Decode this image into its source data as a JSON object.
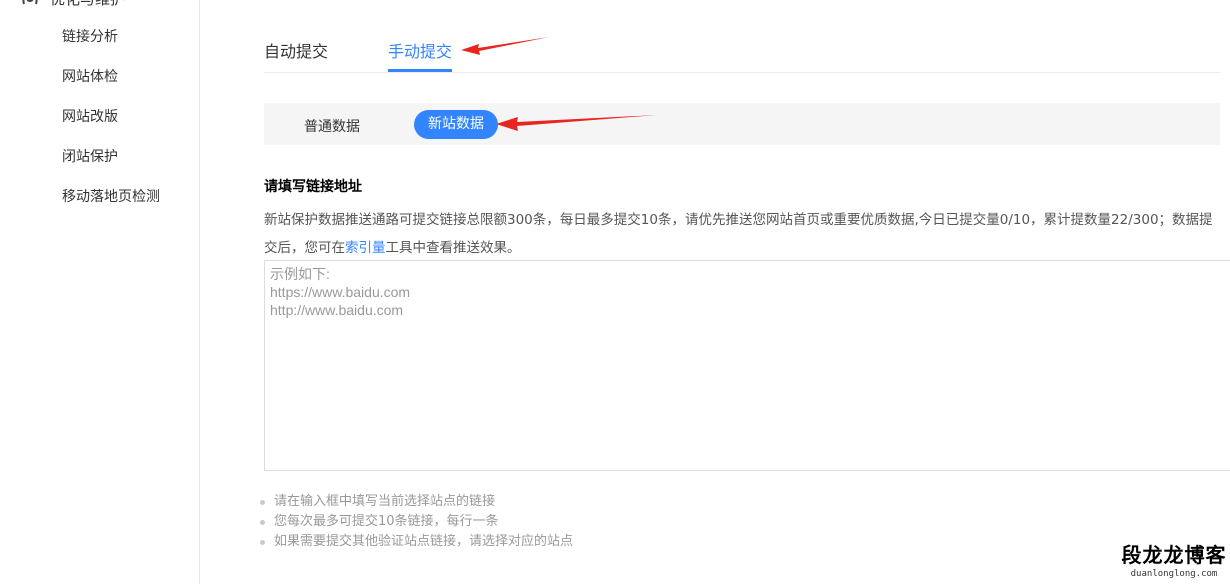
{
  "sidebar": {
    "top_label": "优化与维护",
    "top_chevron": "^",
    "items": [
      {
        "label": "链接分析"
      },
      {
        "label": "网站体检"
      },
      {
        "label": "网站改版"
      },
      {
        "label": "闭站保护"
      },
      {
        "label": "移动落地页检测"
      }
    ]
  },
  "tabs": {
    "auto": "自动提交",
    "manual": "手动提交"
  },
  "subtabs": {
    "normal": "普通数据",
    "new_site": "新站数据"
  },
  "form": {
    "title": "请填写链接地址",
    "desc_part1": "新站保护数据推送通路可提交链接总限额300条，每日最多提交10条，请优先推送您网站首页或重要优质数据,今日已提交量0/10，累计提数量22/300；数据提交后，您可在",
    "desc_link": "索引量",
    "desc_part2": "工具中查看推送效果。",
    "textarea_placeholder": "示例如下:\nhttps://www.baidu.com\nhttp://www.baidu.com"
  },
  "tips": [
    "请在输入框中填写当前选择站点的链接",
    "您每次最多可提交10条链接，每行一条",
    "如果需要提交其他验证站点链接，请选择对应的站点"
  ],
  "watermark": {
    "title": "段龙龙博客",
    "url": "duanlonglong.com"
  },
  "colors": {
    "accent": "#3385ff",
    "annotation_arrow": "#e8261f"
  }
}
